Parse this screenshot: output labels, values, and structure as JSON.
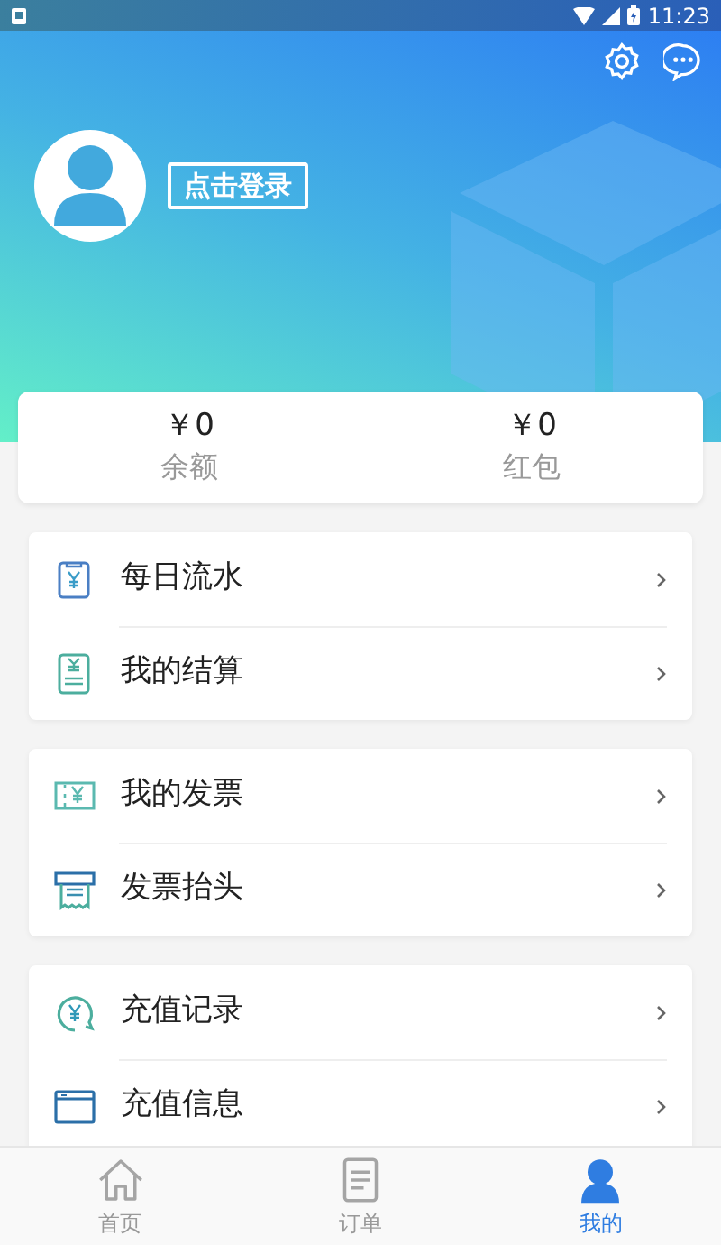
{
  "status_bar": {
    "time": "11:23"
  },
  "header": {
    "login_button": "点击登录"
  },
  "balances": [
    {
      "amount": "￥0",
      "label": "余额"
    },
    {
      "amount": "￥0",
      "label": "红包"
    }
  ],
  "menu_groups": [
    {
      "items": [
        {
          "label": "每日流水"
        },
        {
          "label": "我的结算"
        }
      ]
    },
    {
      "items": [
        {
          "label": "我的发票"
        },
        {
          "label": "发票抬头"
        }
      ]
    },
    {
      "items": [
        {
          "label": "充值记录"
        },
        {
          "label": "充值信息"
        }
      ]
    }
  ],
  "tabs": [
    {
      "label": "首页",
      "selected": false
    },
    {
      "label": "订单",
      "selected": false
    },
    {
      "label": "我的",
      "selected": true
    }
  ]
}
